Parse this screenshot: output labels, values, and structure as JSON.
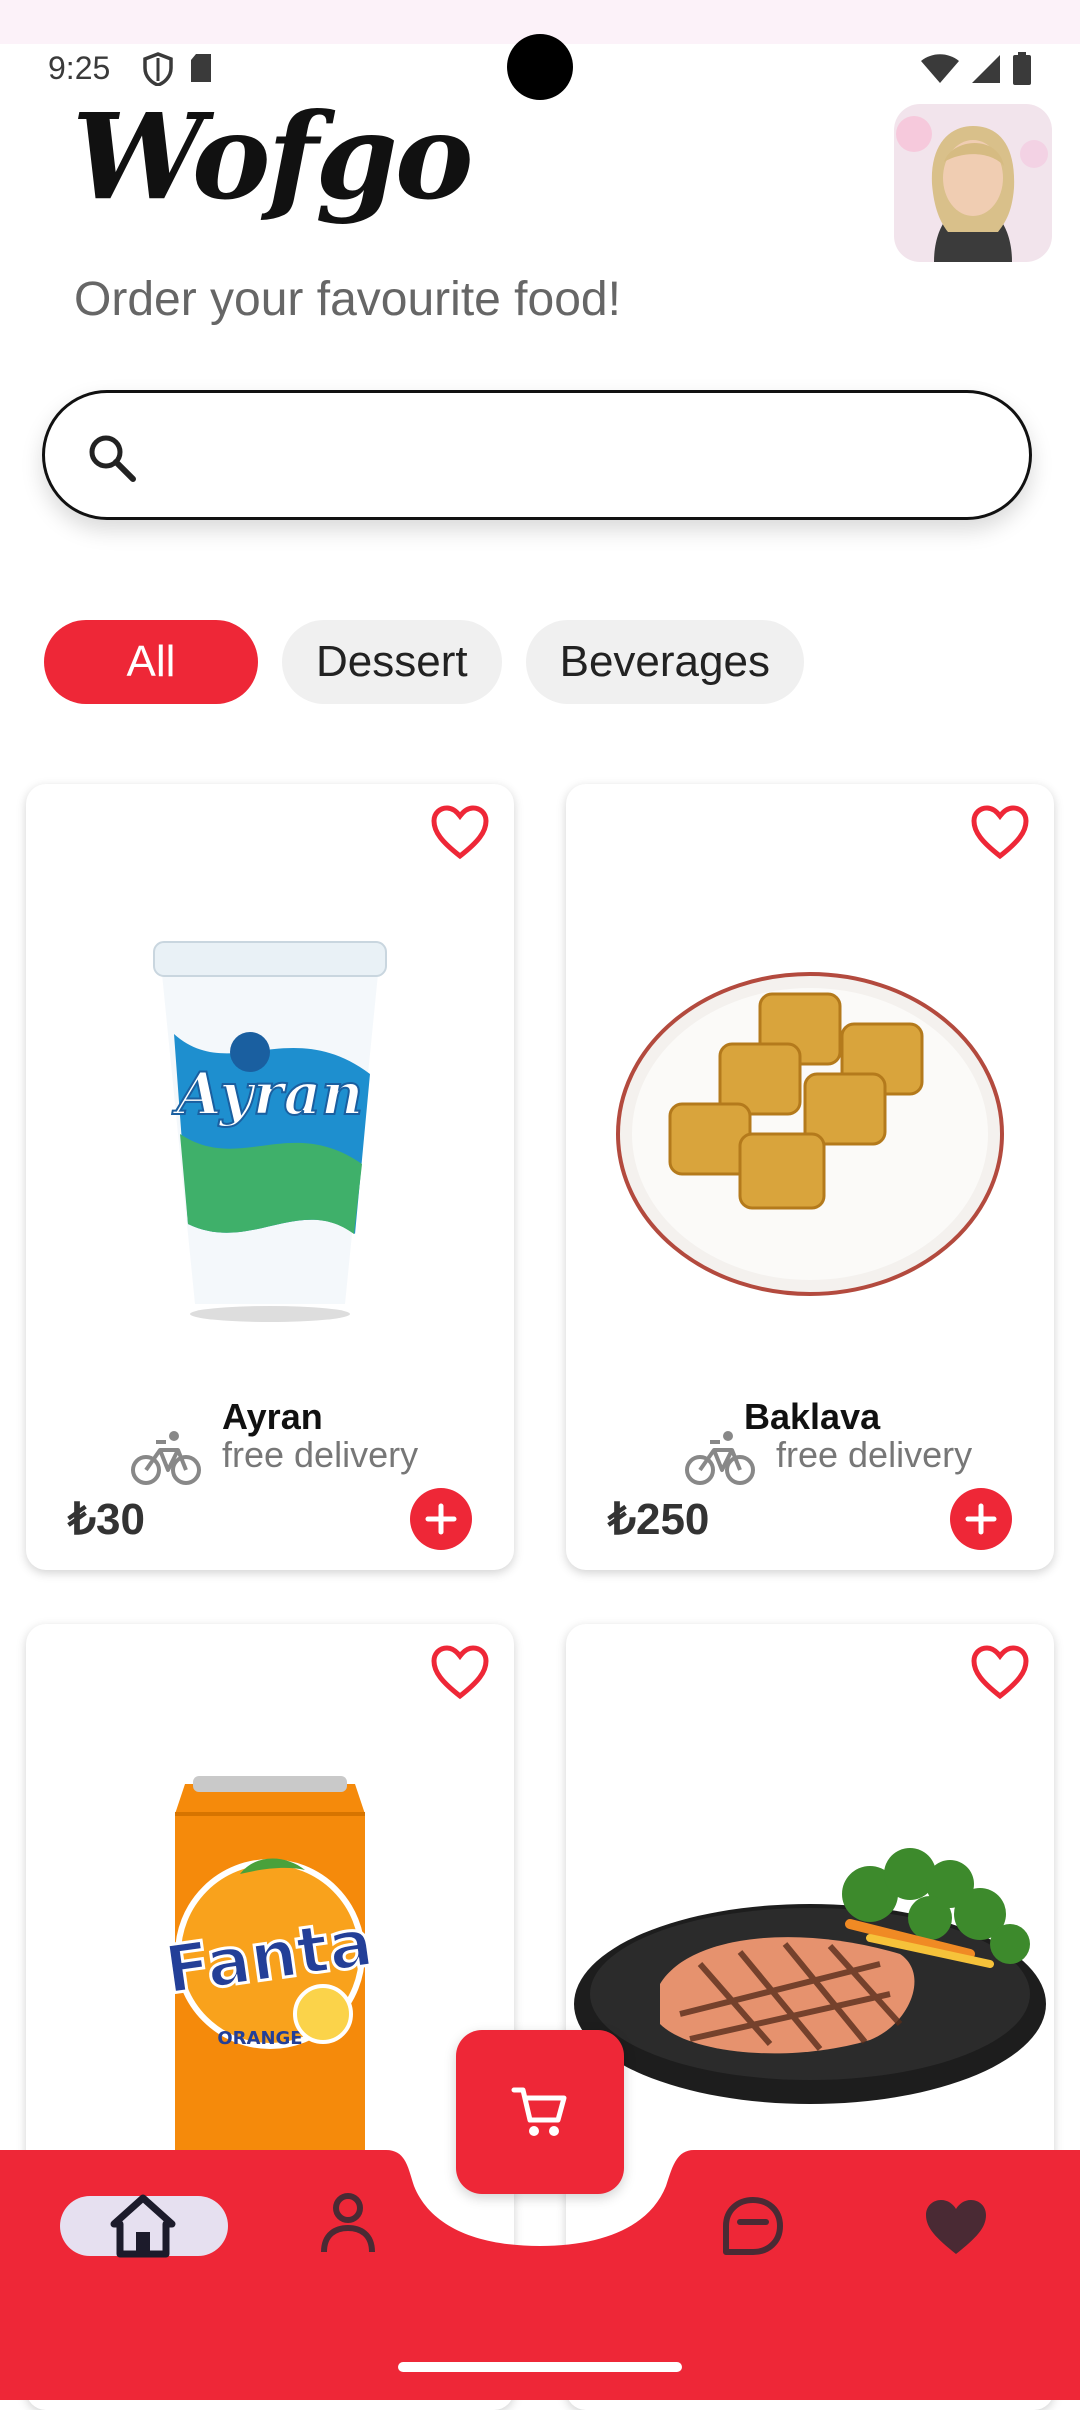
{
  "status": {
    "time": "9:25"
  },
  "header": {
    "app_title": "Wofgo",
    "subtitle": "Order your favourite food!"
  },
  "search": {
    "placeholder": ""
  },
  "categories": [
    "All",
    "Dessert",
    "Beverages"
  ],
  "products": [
    {
      "name": "Ayran",
      "delivery": "free delivery",
      "price": "₺30"
    },
    {
      "name": "Baklava",
      "delivery": "free delivery",
      "price": "₺250"
    },
    {
      "name": "",
      "delivery": "",
      "price": ""
    },
    {
      "name": "",
      "delivery": "",
      "price": ""
    }
  ],
  "product_images": [
    "ayran-cup",
    "baklava-plate",
    "fanta-can",
    "grilled-salmon"
  ],
  "nav": {
    "items": [
      "home-icon",
      "person-icon",
      "chat-bubble-icon",
      "heart-icon"
    ],
    "fab": "cart-icon"
  },
  "colors": {
    "accent": "#ee2737",
    "nav_bg": "#ee2737",
    "chip_inactive": "#f0f0f0",
    "home_pill": "#e6e0f0"
  }
}
